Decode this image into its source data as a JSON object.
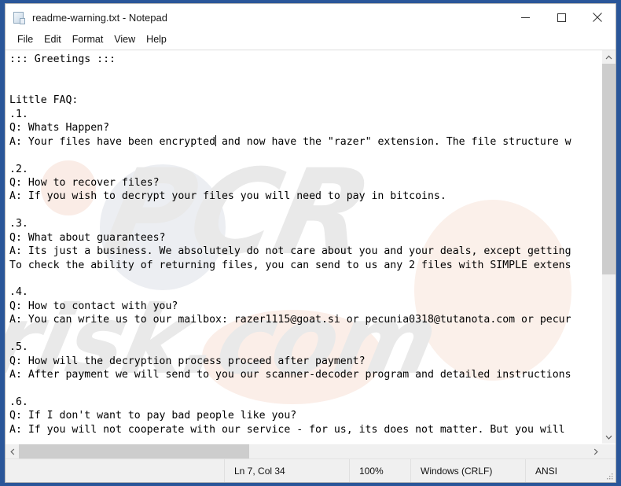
{
  "window": {
    "title": "readme-warning.txt - Notepad",
    "icon": "notepad-document-icon",
    "buttons": {
      "minimize": "minimize-icon",
      "maximize": "maximize-icon",
      "close": "close-icon"
    }
  },
  "menubar": {
    "items": [
      {
        "label": "File"
      },
      {
        "label": "Edit"
      },
      {
        "label": "Format"
      },
      {
        "label": "View"
      },
      {
        "label": "Help"
      }
    ]
  },
  "watermark": {
    "main": "PCR",
    "sub": "risk.com"
  },
  "document": {
    "lines": [
      "::: Greetings :::",
      "",
      "",
      "Little FAQ:",
      ".1.",
      "Q: Whats Happen?",
      "A: Your files have been encrypted| and now have the \"razer\" extension. The file structure w",
      "",
      ".2.",
      "Q: How to recover files?",
      "A: If you wish to decrypt your files you will need to pay in bitcoins.",
      "",
      ".3.",
      "Q: What about guarantees?",
      "A: Its just a business. We absolutely do not care about you and your deals, except getting",
      "To check the ability of returning files, you can send to us any 2 files with SIMPLE extens",
      "",
      ".4.",
      "Q: How to contact with you?",
      "A: You can write us to our mailbox: razer1115@goat.si or pecunia0318@tutanota.com or pecur",
      "",
      ".5.",
      "Q: How will the decryption process proceed after payment?",
      "A: After payment we will send to you our scanner-decoder program and detailed instructions",
      "",
      ".6.",
      "Q: If I don't want to pay bad people like you?",
      "A: If you will not cooperate with our service - for us, its does not matter. But you will"
    ],
    "caret_line_index": 6,
    "caret_marker": "|"
  },
  "statusbar": {
    "position": "Ln 7, Col 34",
    "zoom": "100%",
    "line_ending": "Windows (CRLF)",
    "encoding": "ANSI"
  },
  "scrollbars": {
    "vertical": {
      "up_arrow": "chevron-up-icon",
      "down_arrow": "chevron-down-icon"
    },
    "horizontal": {
      "left_arrow": "chevron-left-icon",
      "right_arrow": "chevron-right-icon"
    }
  },
  "colors": {
    "desktop": "#2a5699",
    "window_bg": "#ffffff",
    "scrollbar_track": "#f0f0f0",
    "scrollbar_thumb": "#cdcdcd",
    "statusbar_bg": "#f0f0f0",
    "text": "#000000"
  }
}
